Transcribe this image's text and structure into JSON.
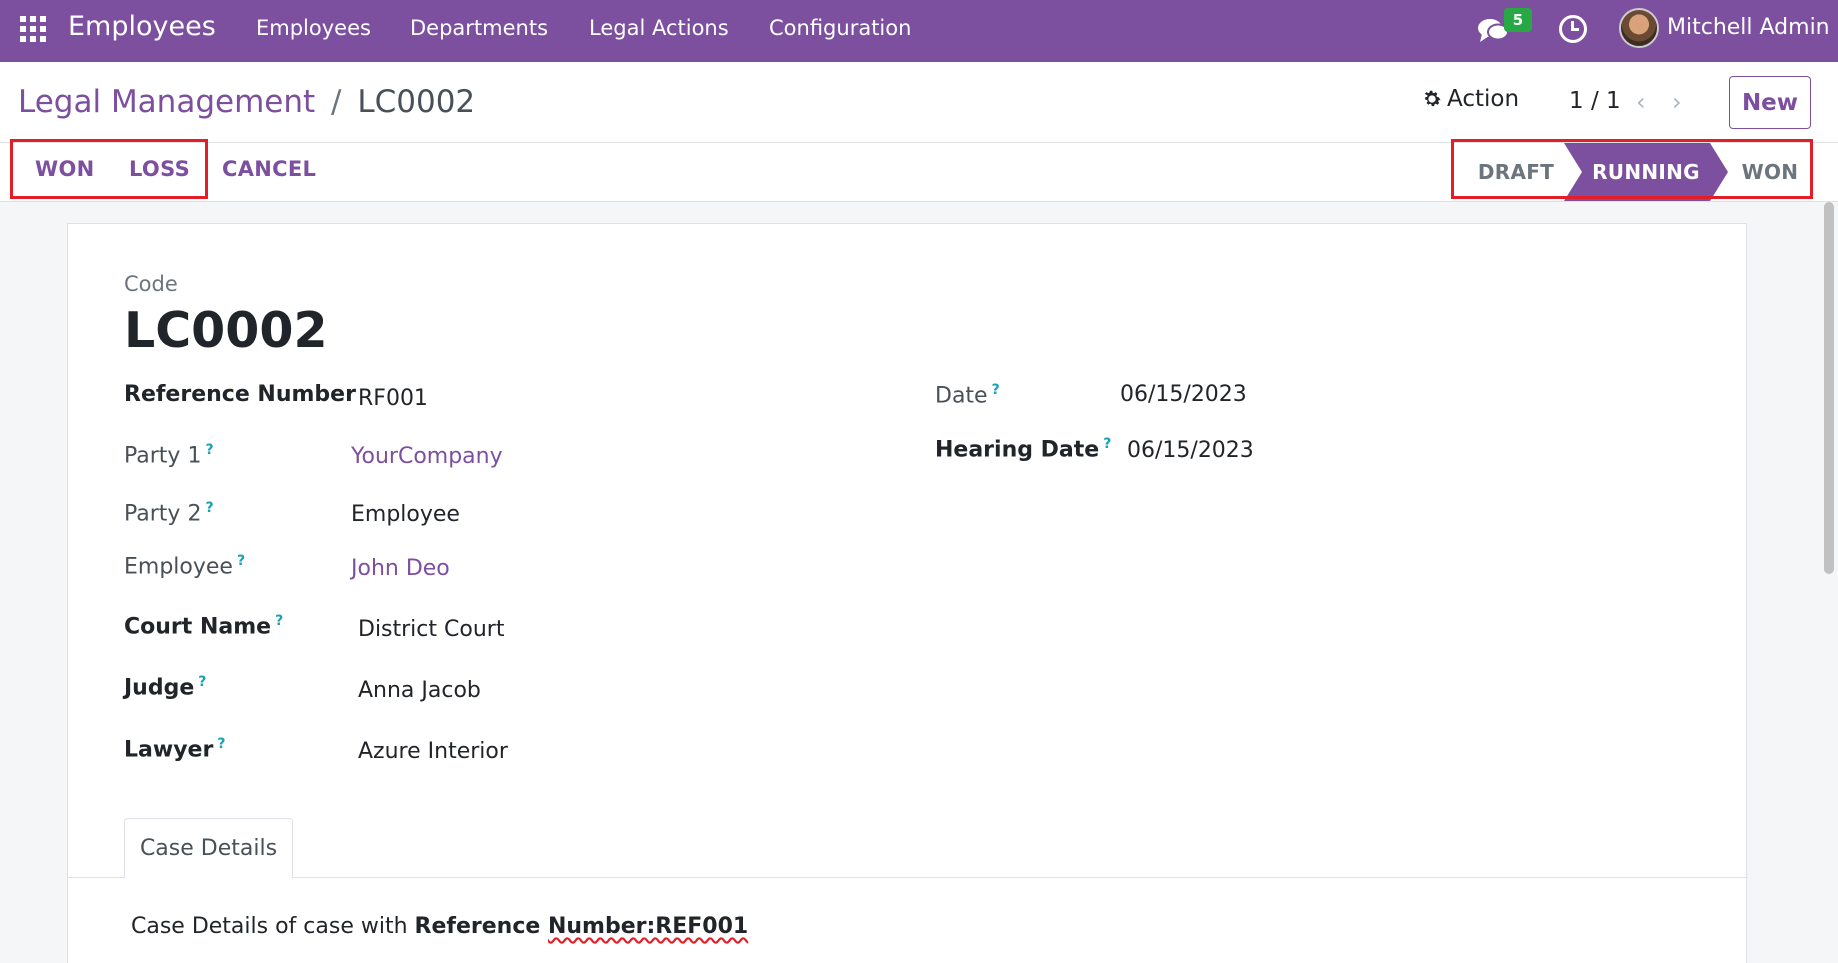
{
  "navbar": {
    "app_title": "Employees",
    "menu": [
      "Employees",
      "Departments",
      "Legal Actions",
      "Configuration"
    ],
    "chat_badge": "5",
    "user_name": "Mitchell Admin",
    "icons": [
      "apps-grid-icon",
      "chat-icon",
      "clock-icon"
    ]
  },
  "control": {
    "breadcrumb_parent": "Legal Management",
    "breadcrumb_sep": "/",
    "breadcrumb_current": "LC0002",
    "action_label": "Action",
    "pager": "1 / 1",
    "new_label": "New"
  },
  "statusbar": {
    "buttons": [
      "WON",
      "LOSS",
      "CANCEL"
    ],
    "stages": [
      "DRAFT",
      "RUNNING",
      "WON"
    ],
    "active_stage": "RUNNING",
    "highlight_color": "#e41e26"
  },
  "form": {
    "code_label": "Code",
    "code_value": "LC0002",
    "fields_left": [
      {
        "label": "Reference Number",
        "value": "RF001"
      },
      {
        "label": "Party 1",
        "value": "YourCompany"
      },
      {
        "label": "Party 2",
        "value": "Employee"
      },
      {
        "label": "Employee",
        "value": "John Deo"
      },
      {
        "label": "Court Name",
        "value": "District Court"
      },
      {
        "label": "Judge",
        "value": "Anna Jacob"
      },
      {
        "label": "Lawyer",
        "value": "Azure Interior"
      }
    ],
    "fields_right": [
      {
        "label": "Date",
        "value": "06/15/2023"
      },
      {
        "label": "Hearing Date",
        "value": "06/15/2023"
      }
    ],
    "help_mark": "?"
  },
  "tabs": {
    "active_tab": "Case Details",
    "content_prefix": "Case Details of case with ",
    "content_bold_1": "Reference ",
    "content_bold_2": "Number:REF001"
  },
  "colors": {
    "brand": "#7c4f9f",
    "badge": "#28a745",
    "help": "#17a2b8"
  }
}
